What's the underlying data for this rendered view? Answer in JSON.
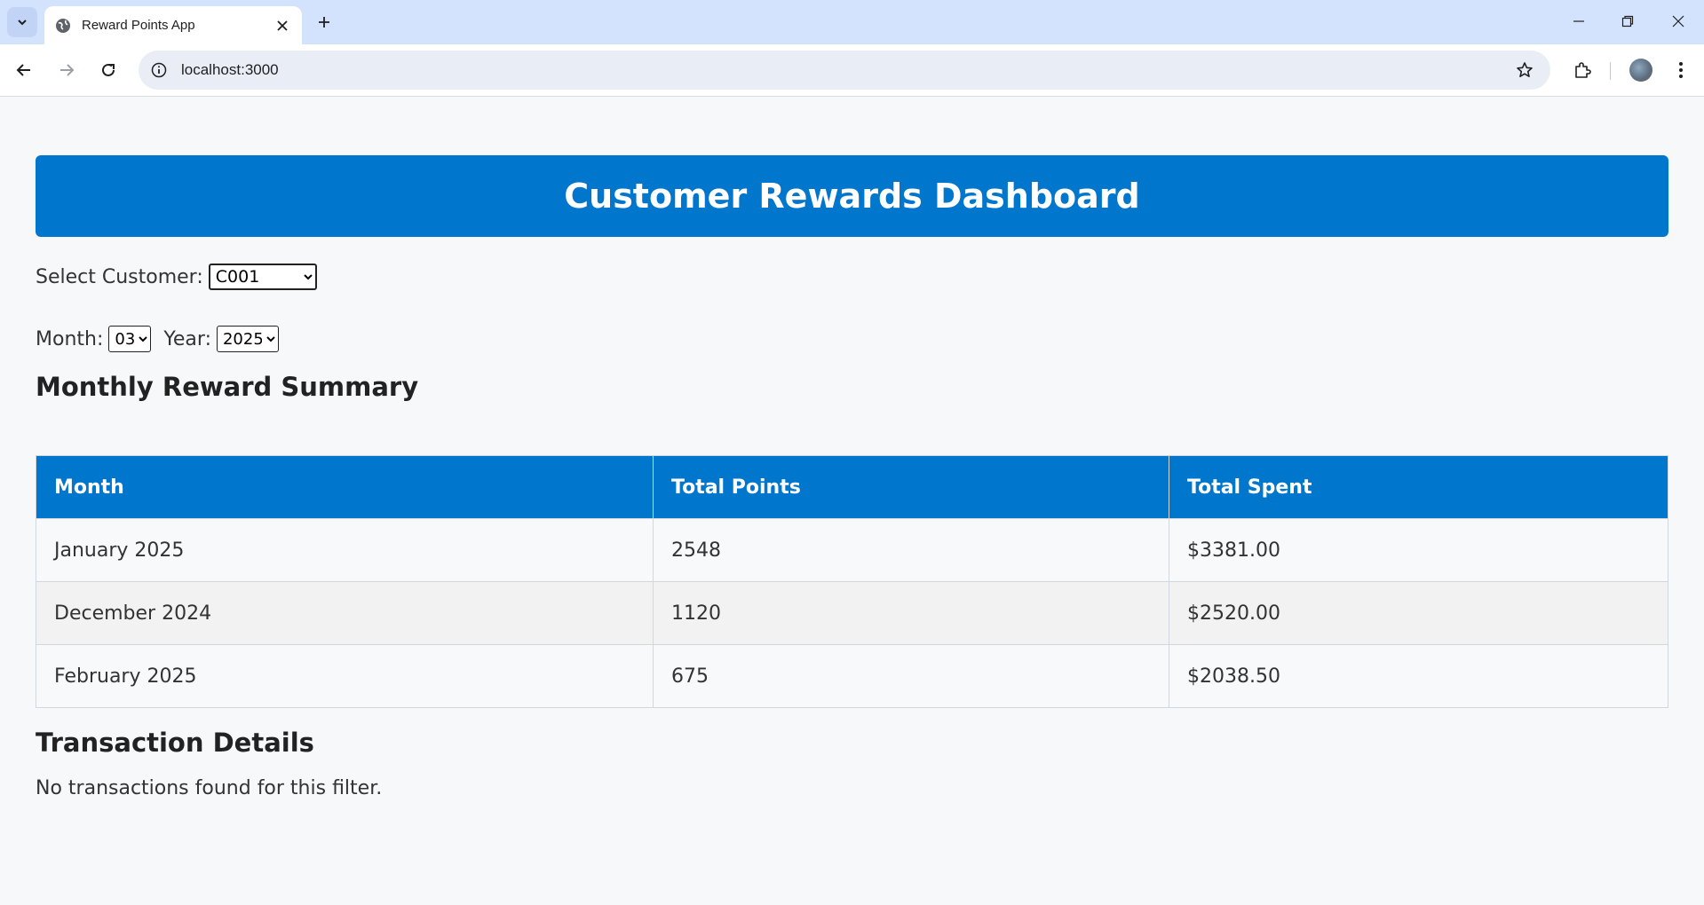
{
  "browser": {
    "tab_title": "Reward Points App",
    "url": "localhost:3000"
  },
  "page": {
    "title": "Customer Rewards Dashboard",
    "customer_label": "Select Customer:",
    "customer_value": "C001",
    "month_label": "Month:",
    "month_value": "03",
    "year_label": "Year:",
    "year_value": "2025",
    "summary_title": "Monthly Reward Summary",
    "table": {
      "headers": [
        "Month",
        "Total Points",
        "Total Spent"
      ],
      "rows": [
        [
          "January 2025",
          "2548",
          "$3381.00"
        ],
        [
          "December 2024",
          "1120",
          "$2520.00"
        ],
        [
          "February 2025",
          "675",
          "$2038.50"
        ]
      ]
    },
    "transactions_title": "Transaction Details",
    "empty_message": "No transactions found for this filter."
  },
  "colors": {
    "accent": "#0077cc",
    "tabbar": "#d3e3fd"
  }
}
